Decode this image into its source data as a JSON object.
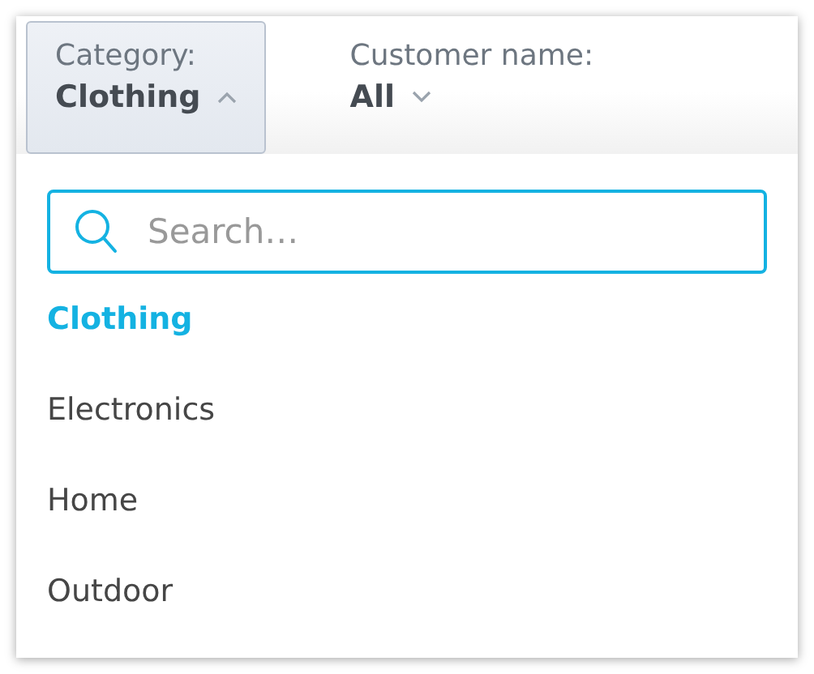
{
  "filters": [
    {
      "label": "Category:",
      "value": "Clothing",
      "expanded": true
    },
    {
      "label": "Customer name:",
      "value": "All",
      "expanded": false
    }
  ],
  "search": {
    "placeholder": "Search…"
  },
  "items": [
    {
      "label": "Clothing",
      "selected": true
    },
    {
      "label": "Electronics",
      "selected": false
    },
    {
      "label": "Home",
      "selected": false
    },
    {
      "label": "Outdoor",
      "selected": false
    }
  ]
}
